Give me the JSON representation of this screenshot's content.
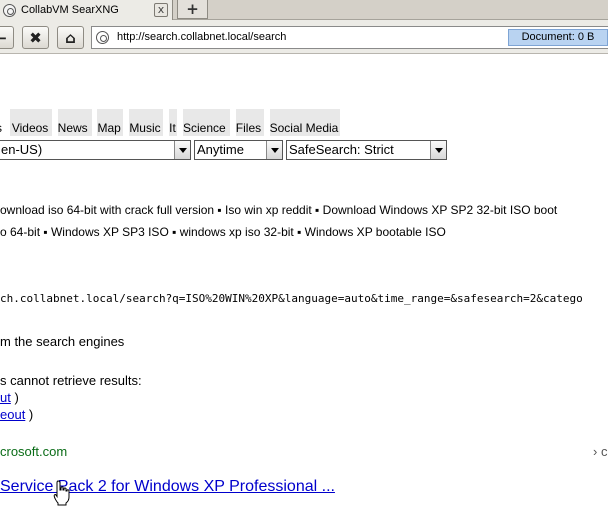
{
  "tab": {
    "title": "CollabVM SearXNG",
    "close_glyph": "x",
    "new_tab_glyph": "+"
  },
  "toolbar": {
    "back_glyph": "←",
    "stop_glyph": "✖",
    "home_glyph": "⌂",
    "url": "http://search.collabnet.local/search",
    "document_status": "Document:    0 B"
  },
  "categories": [
    {
      "label": "s",
      "selected": true
    },
    {
      "label": "Videos"
    },
    {
      "label": "News"
    },
    {
      "label": "Map"
    },
    {
      "label": "Music"
    },
    {
      "label": "It"
    },
    {
      "label": "Science"
    },
    {
      "label": "Files"
    },
    {
      "label": "Social Media"
    }
  ],
  "filters": {
    "language": "en-US)",
    "time_range": "Anytime",
    "safesearch": "SafeSearch: Strict"
  },
  "suggestions": {
    "line1": "ownload iso 64-bit with crack full version  ▪ Iso win xp reddit  ▪ Download Windows XP SP2 32-bit ISO boot",
    "line2": "o 64-bit  ▪ Windows XP SP3 ISO  ▪ windows xp iso 32-bit  ▪ Windows XP bootable ISO"
  },
  "search_url_text": "ch.collabnet.local/search?q=ISO%20WIN%20XP&language=auto&time_range=&safesearch=2&catego",
  "engines_heading": "m the search engines",
  "errors": {
    "heading": "s cannot retrieve results:",
    "item1": "ut",
    "item1_suffix": " )",
    "item2": "eout",
    "item2_suffix": " )"
  },
  "result": {
    "host": "crosoft.com",
    "cached": "› c",
    "title": "Service Pack 2 for Windows XP Professional ..."
  },
  "colors": {
    "link": "#0000cc",
    "url_green": "#0a6c17",
    "doc_status_bg": "#b9d3f1"
  }
}
